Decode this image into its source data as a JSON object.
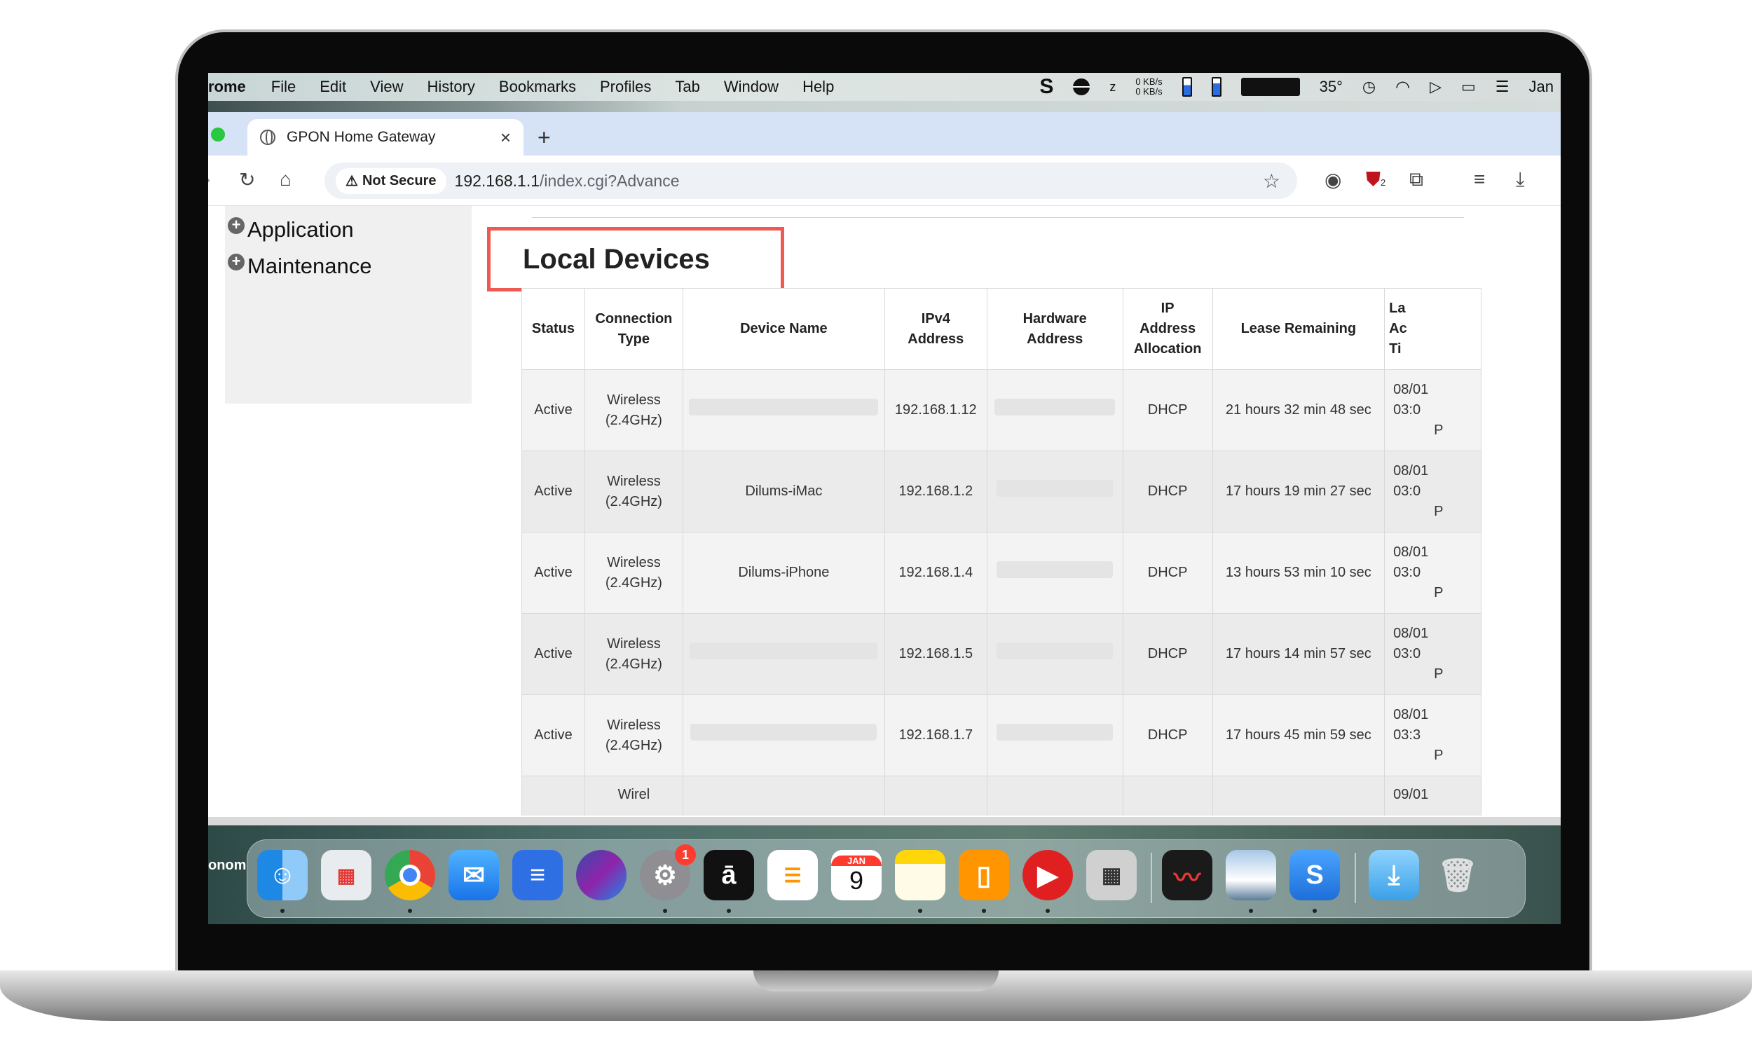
{
  "menubar": {
    "app_name": "rome",
    "items": [
      "File",
      "Edit",
      "View",
      "History",
      "Bookmarks",
      "Profiles",
      "Tab",
      "Window",
      "Help"
    ],
    "net_up": "0 KB/s",
    "net_down": "0 KB/s",
    "temperature": "35°",
    "clock": "Jan"
  },
  "browser": {
    "tab_title": "GPON Home Gateway",
    "tab_close": "×",
    "new_tab": "+",
    "security_label": "Not Secure",
    "url_host": "192.168.1.1",
    "url_path": "/index.cgi?Advance",
    "extension_badge": "2"
  },
  "sidebar": {
    "items": [
      {
        "label": "Application"
      },
      {
        "label": "Maintenance"
      }
    ]
  },
  "section": {
    "title": "Local Devices"
  },
  "table": {
    "headers": [
      "Status",
      "Connection Type",
      "Device Name",
      "IPv4 Address",
      "Hardware Address",
      "IP Address Allocation",
      "Lease Remaining",
      "Last Active Time"
    ],
    "header_lines": {
      "connection": [
        "Connection",
        "Type"
      ],
      "ipv4": [
        "IPv4",
        "Address"
      ],
      "hardware": [
        "Hardware",
        "Address"
      ],
      "allocation": [
        "IP",
        "Address",
        "Allocation"
      ],
      "last": [
        "La",
        "Ac",
        "Ti"
      ]
    },
    "rows": [
      {
        "status": "Active",
        "conn1": "Wireless",
        "conn2": "(2.4GHz)",
        "device": "",
        "ip": "192.168.1.12",
        "alloc": "DHCP",
        "lease": "21 hours 32 min 48 sec",
        "last1": "08/01",
        "last2": "03:0",
        "last3": "P"
      },
      {
        "status": "Active",
        "conn1": "Wireless",
        "conn2": "(2.4GHz)",
        "device": "Dilums-iMac",
        "ip": "192.168.1.2",
        "alloc": "DHCP",
        "lease": "17 hours 19 min 27 sec",
        "last1": "08/01",
        "last2": "03:0",
        "last3": "P"
      },
      {
        "status": "Active",
        "conn1": "Wireless",
        "conn2": "(2.4GHz)",
        "device": "Dilums-iPhone",
        "ip": "192.168.1.4",
        "alloc": "DHCP",
        "lease": "13 hours 53 min 10 sec",
        "last1": "08/01",
        "last2": "03:0",
        "last3": "P"
      },
      {
        "status": "Active",
        "conn1": "Wireless",
        "conn2": "(2.4GHz)",
        "device": "",
        "ip": "192.168.1.5",
        "alloc": "DHCP",
        "lease": "17 hours 14 min 57 sec",
        "last1": "08/01",
        "last2": "03:0",
        "last3": "P"
      },
      {
        "status": "Active",
        "conn1": "Wireless",
        "conn2": "(2.4GHz)",
        "device": "",
        "ip": "192.168.1.7",
        "alloc": "DHCP",
        "lease": "17 hours 45 min 59 sec",
        "last1": "08/01",
        "last2": "03:3",
        "last3": "P"
      }
    ],
    "partial_row": {
      "conn1": "Wirel",
      "last1": "09/01"
    }
  },
  "desktop": {
    "label": "onom"
  },
  "dock": {
    "settings_badge": "1",
    "calendar_month": "JAN",
    "calendar_day": "9"
  },
  "colors": {
    "highlight_box": "#ee5a52",
    "tabbar": "#d6e3f7"
  }
}
